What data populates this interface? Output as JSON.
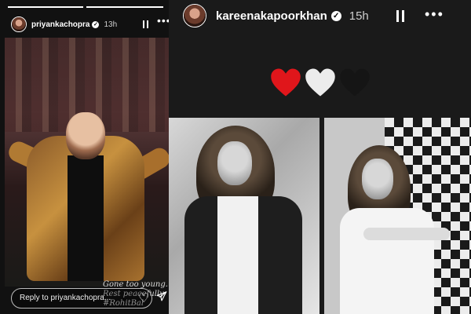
{
  "left_story": {
    "username": "priyankachopra",
    "time": "13h",
    "caption_lines": [
      "Gone too young.",
      "Rest peacefully",
      "#RohitBal"
    ],
    "reply_placeholder": "Reply to priyankachopra..."
  },
  "right_story": {
    "username": "kareenakapoorkhan",
    "time": "15h",
    "emojis": [
      {
        "name": "red-heart",
        "color": "#e0161b"
      },
      {
        "name": "white-heart",
        "color": "#ececec"
      },
      {
        "name": "black-heart",
        "color": "#151515"
      }
    ]
  },
  "colors": {
    "background": "#000000",
    "text": "#ffffff",
    "verified": "#ffffff"
  },
  "icons": [
    "verified-badge-icon",
    "pause-icon",
    "more-icon",
    "heart-icon",
    "send-icon"
  ]
}
